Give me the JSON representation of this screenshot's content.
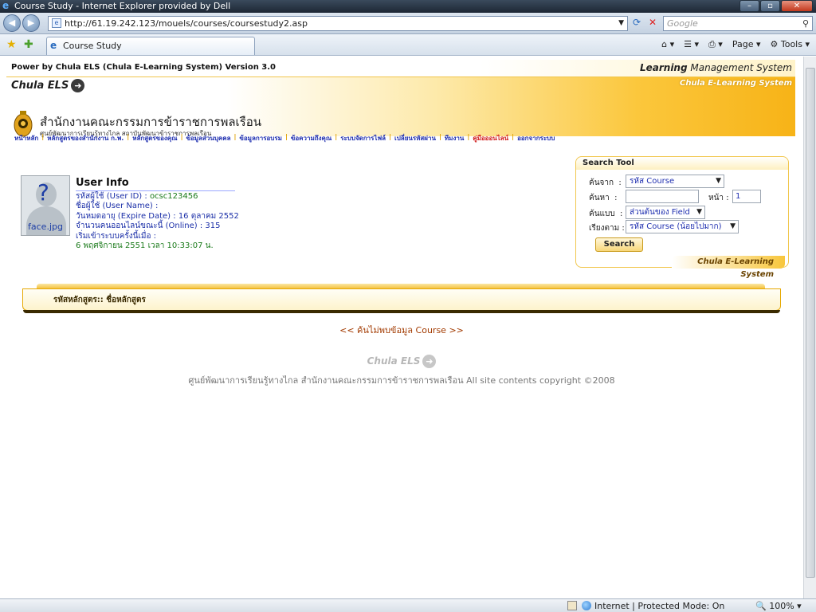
{
  "window": {
    "title": "Course Study - Internet Explorer provided by Dell"
  },
  "browser": {
    "url": "http://61.19.242.123/mouels/courses/coursestudy2.asp",
    "search_placeholder": "Google",
    "tab_title": "Course Study",
    "page_label": "Page",
    "tools_label": "Tools"
  },
  "header": {
    "powered": "Power by Chula ELS (Chula E-Learning System) Version 3.0",
    "lms_bold": "Learning",
    "lms_rest": " Management System",
    "logo": "Chula ELS",
    "org_name": "สำนักงานคณะกรรมการข้าราชการพลเรือน",
    "org_sub": "ศูนย์พัฒนาการเรียนรู้ทางไกล สถาบันพัฒนาข้าราชการพลเรือน",
    "banner_right": "Chula E-Learning System"
  },
  "menu": [
    "หน้าหลัก",
    "หลักสูตรของสำนักงาน ก.พ.",
    "หลักสูตรของคุณ",
    "ข้อมูลส่วนบุคคล",
    "ข้อมูลการอบรม",
    "ข้อความถึงคุณ",
    "ระบบจัดการไฟล์",
    "เปลี่ยนรหัสผ่าน",
    "ทีมงาน",
    "คู่มือออนไลน์",
    "ออกจากระบบ"
  ],
  "user": {
    "avatar_caption": "face.jpg",
    "title": "User Info",
    "id_label": "รหัสผู้ใช้ (User ID) : ",
    "id_value": "ocsc123456",
    "name_label": "ชื่อผู้ใช้ (User Name) :",
    "expire_label": "วันหมดอายุ (Expire Date) : ",
    "expire_value": "16 ตุลาคม 2552",
    "online_label": "จำนวนคนออนไลน์ขณะนี้ (Online) : ",
    "online_value": "315",
    "since_label": "เริ่มเข้าระบบครั้งนี้เมื่อ :",
    "since_value": "6 พฤศจิกายน 2551 เวลา 10:33:07 น."
  },
  "search": {
    "title": "Search Tool",
    "from_label": "ค้นจาก",
    "from_value": "รหัส Course",
    "query_label": "ค้นหา",
    "query_value": "",
    "page_label": "หน้า :",
    "page_value": "1",
    "mode_label": "ค้นแบบ",
    "mode_value": "ส่วนต้นของ Field",
    "sort_label": "เรียงตาม",
    "sort_value": "รหัส Course (น้อยไปมาก)",
    "button": "Search",
    "footer": "Chula E-Learning System"
  },
  "course": {
    "header": "รหัสหลักสูตร:: ชื่อหลักสูตร",
    "not_found": "<< ค้นไม่พบข้อมูล Course >>"
  },
  "footer": {
    "logo": "Chula ELS",
    "copyright": "ศูนย์พัฒนาการเรียนรู้ทางไกล สำนักงานคณะกรรมการข้าราชการพลเรือน All site contents copyright ©2008"
  },
  "status": {
    "zone": "Internet | Protected Mode: On",
    "zoom": "100%"
  }
}
